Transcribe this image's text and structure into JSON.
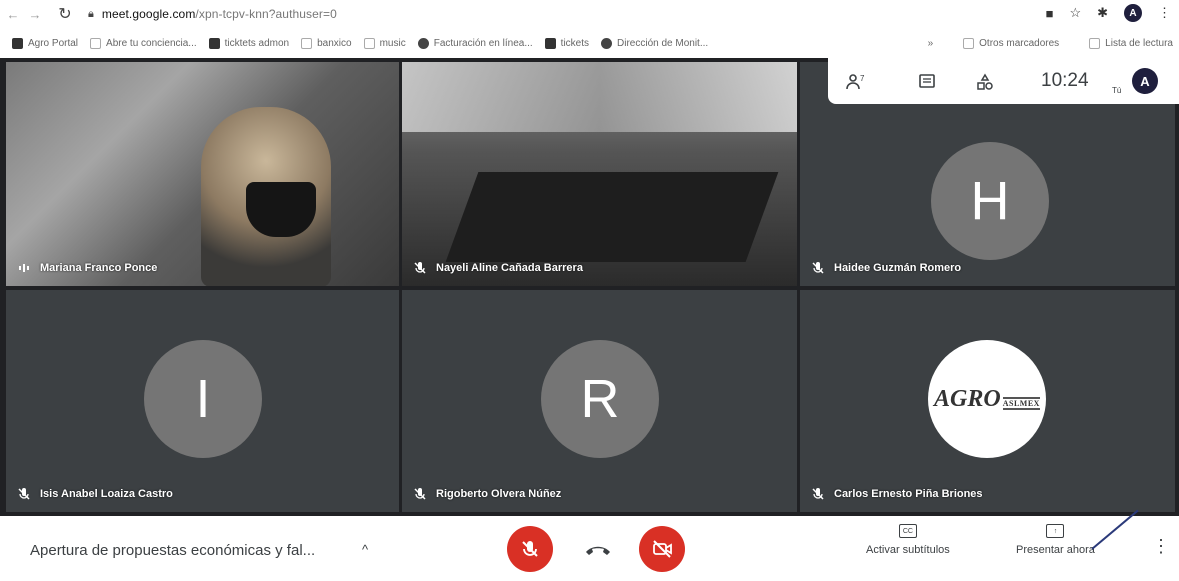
{
  "browser": {
    "url_host": "meet.google.com",
    "url_path": "/xpn-tcpv-knn?authuser=0",
    "profile_initial": "A"
  },
  "bookmarks": {
    "items": [
      {
        "label": "Agro Portal",
        "icon": "grid-icon"
      },
      {
        "label": "Abre tu conciencia...",
        "icon": "page-icon"
      },
      {
        "label": "ticktets admon",
        "icon": "app-icon"
      },
      {
        "label": "banxico",
        "icon": "page-icon"
      },
      {
        "label": "music",
        "icon": "page-icon"
      },
      {
        "label": "Facturación en línea...",
        "icon": "globe-icon"
      },
      {
        "label": "tickets",
        "icon": "app-icon"
      },
      {
        "label": "Dirección de Monit...",
        "icon": "bird-icon"
      }
    ],
    "more": "»",
    "other_favorites": "Otros marcadores",
    "reading_list": "Lista de lectura"
  },
  "meet_toolbar": {
    "time": "10:24",
    "you_label": "Tú",
    "me_initial": "A"
  },
  "participants": [
    {
      "name": "Mariana Franco Ponce",
      "type": "video",
      "mic": "speaking"
    },
    {
      "name": "Nayeli Aline Cañada Barrera",
      "type": "video",
      "mic": "muted"
    },
    {
      "name": "Haidee Guzmán Romero",
      "type": "avatar",
      "initial": "H",
      "mic": "muted"
    },
    {
      "name": "Isis Anabel Loaiza Castro",
      "type": "avatar",
      "initial": "I",
      "mic": "muted"
    },
    {
      "name": "Rigoberto Olvera Núñez",
      "type": "avatar",
      "initial": "R",
      "mic": "muted"
    },
    {
      "name": "Carlos Ernesto Piña Briones",
      "type": "logo",
      "logo_text": "AGRO",
      "logo_sub": "ASLMEX",
      "mic": "muted"
    }
  ],
  "bottom": {
    "meeting_title": "Apertura de propuestas económicas y fal...",
    "captions_label": "Activar subtítulos",
    "captions_icon": "CC",
    "present_label": "Presentar ahora"
  },
  "colors": {
    "stage_bg": "#202124",
    "tile_bg": "#3c4043",
    "danger": "#d93025"
  }
}
